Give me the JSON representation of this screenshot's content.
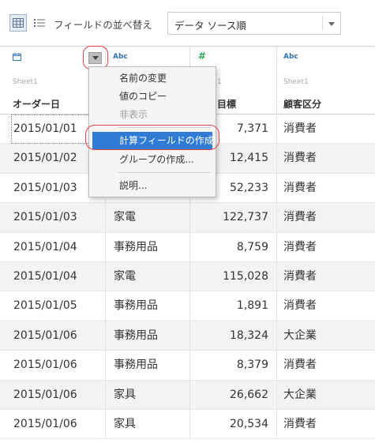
{
  "toolbar": {
    "sort_label": "フィールドの並べ替え",
    "sort_value": "データ ソース順",
    "grid_icon": "grid-view-icon",
    "list_icon": "list-view-icon"
  },
  "columns": [
    {
      "type": "date",
      "type_icon": "calendar-icon",
      "source": "Sheet1",
      "name": "オーダー日"
    },
    {
      "type": "string",
      "type_label": "Abc",
      "source": "Sheet1",
      "name": ""
    },
    {
      "type": "number",
      "type_label": "#",
      "source": "1",
      "name": "目標"
    },
    {
      "type": "string",
      "type_label": "Abc",
      "source": "Sheet1",
      "name": "顧客区分"
    }
  ],
  "rows": [
    {
      "date": "2015/01/01",
      "category": "",
      "sales": "7,371",
      "segment": "消費者"
    },
    {
      "date": "2015/01/02",
      "category": "",
      "sales": "12,415",
      "segment": "消費者"
    },
    {
      "date": "2015/01/03",
      "category": "",
      "sales": "52,233",
      "segment": "消費者"
    },
    {
      "date": "2015/01/03",
      "category": "家電",
      "sales": "122,737",
      "segment": "消費者"
    },
    {
      "date": "2015/01/04",
      "category": "事務用品",
      "sales": "8,759",
      "segment": "消費者"
    },
    {
      "date": "2015/01/04",
      "category": "家電",
      "sales": "115,028",
      "segment": "消費者"
    },
    {
      "date": "2015/01/05",
      "category": "事務用品",
      "sales": "1,891",
      "segment": "消費者"
    },
    {
      "date": "2015/01/06",
      "category": "事務用品",
      "sales": "18,324",
      "segment": "大企業"
    },
    {
      "date": "2015/01/06",
      "category": "事務用品",
      "sales": "8,379",
      "segment": "消費者"
    },
    {
      "date": "2015/01/06",
      "category": "家具",
      "sales": "26,662",
      "segment": "大企業"
    },
    {
      "date": "2015/01/06",
      "category": "家具",
      "sales": "20,534",
      "segment": "消費者"
    }
  ],
  "menu": {
    "rename": "名前の変更",
    "copy_values": "値のコピー",
    "hide": "非表示",
    "create_calc_field": "計算フィールドの作成...",
    "create_group": "グループの作成...",
    "describe": "説明..."
  },
  "colors": {
    "accent": "#2f7bd6",
    "annotation": "#e0444a",
    "type_icon": "#2f75b5"
  }
}
